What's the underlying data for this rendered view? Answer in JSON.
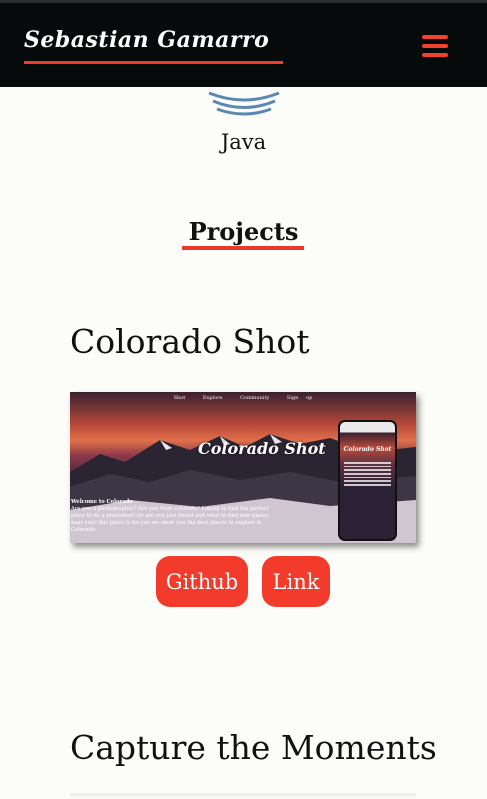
{
  "header": {
    "brand": "Sebastian Gamarro",
    "menu_icon": "hamburger-menu-icon",
    "background": "#070a0a",
    "accent": "#ef3b2c"
  },
  "skills": {
    "current_item": {
      "label": "Java",
      "icon": "java-logo-icon"
    }
  },
  "projects_section": {
    "title": "Projects"
  },
  "projects": [
    {
      "title": "Colorado Shot",
      "screenshot": {
        "nav": [
          "Shot",
          "Explore",
          "Community",
          "Sign up"
        ],
        "brand": "Colorado Shot",
        "welcome_heading": "Welcome to Colorado",
        "welcome_text": "Are you a photographer? Are you from colorado? Loking to find the perfect place to do a photoshot? Or are you just bored and what to find new places near you? this place is for you we show you the best places to explore in Colorado."
      },
      "buttons": {
        "github": "Github",
        "link": "Link"
      }
    },
    {
      "title": "Capture the Moments"
    }
  ]
}
